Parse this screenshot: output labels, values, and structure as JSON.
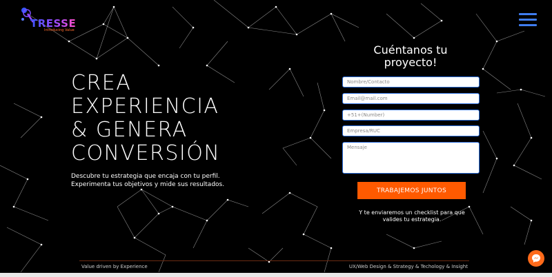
{
  "brand": {
    "wordmark": "TRESSE",
    "tagline": "Introducing Value"
  },
  "hero": {
    "title_lines": [
      "CREA",
      "EXPERIENCIA",
      "& GENERA",
      "CONVERSIÓN"
    ],
    "subtitle_line1": "Descubre tu estrategia que encaja con tu perfil.",
    "subtitle_line2": "Experimenta tus objetivos y mide sus resultados."
  },
  "form": {
    "title_line1": "Cuéntanos tu",
    "title_line2": "proyecto!",
    "name_placeholder": "Nombre/Contacto",
    "email_placeholder": "Email@mail.com",
    "phone_placeholder": "+51+(Number)",
    "company_placeholder": "Empresa/RUC",
    "message_placeholder": "Mensaje",
    "submit_label": "TRABAJEMOS JUNTOS",
    "note_line1": "Y te enviaremos un checklist para que",
    "note_line2": "valides tu estrategia."
  },
  "footer": {
    "left": "Value driven by Experience",
    "right": "UX/Web Design & Strategy & Techology & Insight"
  },
  "colors": {
    "accent": "#ff5a00",
    "menu": "#3f7df0",
    "field_border": "#2c6fe0",
    "background": "#000000"
  },
  "icons": {
    "menu": "hamburger-icon",
    "chat": "messenger-icon",
    "logo": "tresse-logo-icon"
  }
}
